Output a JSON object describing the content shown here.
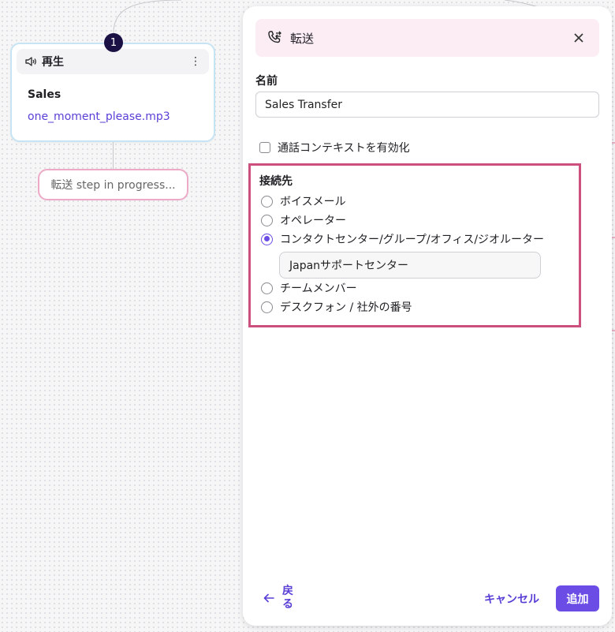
{
  "canvas": {
    "step_number": "1",
    "node": {
      "title": "再生",
      "icon": "speaker-icon",
      "menu_icon": "⋮",
      "name": "Sales",
      "file": "one_moment_please.mp3"
    },
    "pending_step": "転送 step in progress..."
  },
  "panel": {
    "title": "転送",
    "header_icon": "phone-transfer-icon",
    "header_bg": "#fbedf3",
    "name_label": "名前",
    "name_value": "Sales Transfer",
    "context_checkbox_label": "通話コンテキストを有効化",
    "context_checkbox_checked": false,
    "destination": {
      "label": "接続先",
      "highlight_color": "#cd4f7d",
      "options": [
        {
          "label": "ボイスメール",
          "selected": false
        },
        {
          "label": "オペレーター",
          "selected": false
        },
        {
          "label": "コンタクトセンター/グループ/オフィス/ジオルーター",
          "selected": true
        },
        {
          "label": "チームメンバー",
          "selected": false
        },
        {
          "label": "デスクフォン / 社外の番号",
          "selected": false
        }
      ],
      "selected_target": "Japanサポートセンター"
    },
    "footer": {
      "back_label": "戻る",
      "cancel_label": "キャンセル",
      "add_label": "追加",
      "accent_color": "#6b4de6"
    }
  }
}
